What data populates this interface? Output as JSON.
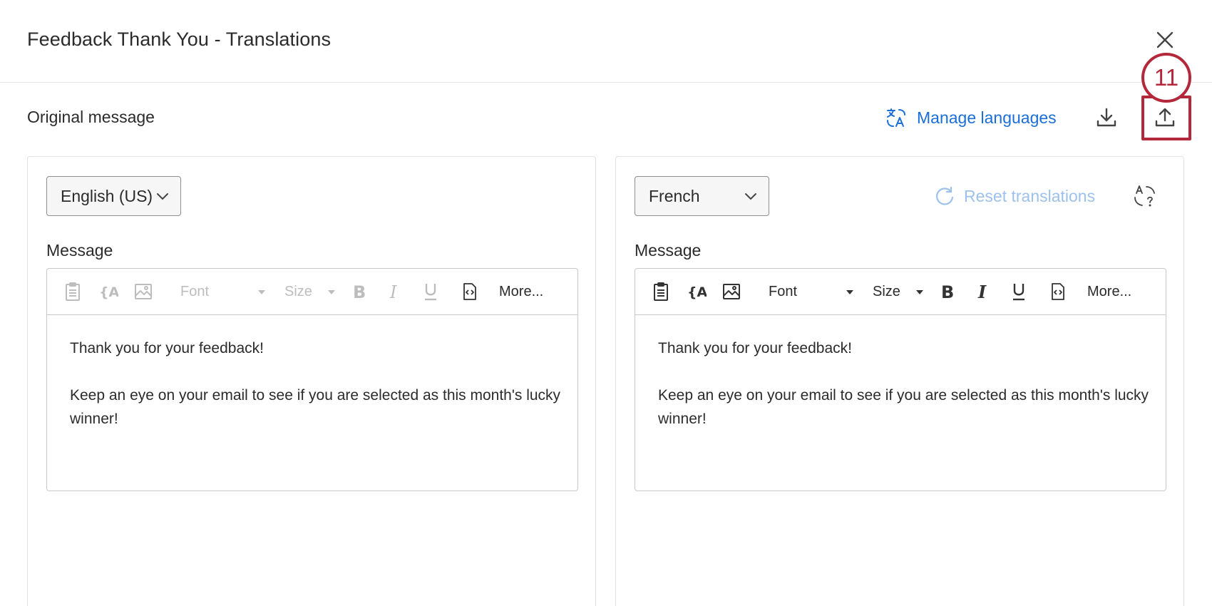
{
  "dialog": {
    "title": "Feedback Thank You - Translations"
  },
  "top_row": {
    "original_label": "Original message",
    "manage_languages_label": "Manage languages"
  },
  "callout": {
    "number": "11"
  },
  "left_panel": {
    "language": "English (US)",
    "message_label": "Message",
    "toolbar": {
      "font_label": "Font",
      "size_label": "Size",
      "more_label": "More..."
    },
    "body": {
      "line1": "Thank you for your feedback!",
      "line2": "Keep an eye on your email to see if you are selected as this month's lucky winner!"
    }
  },
  "right_panel": {
    "language": "French",
    "reset_label": "Reset translations",
    "message_label": "Message",
    "toolbar": {
      "font_label": "Font",
      "size_label": "Size",
      "more_label": "More..."
    },
    "body": {
      "line1": "Thank you for your feedback!",
      "line2": "Keep an eye on your email to see if you are selected as this month's lucky winner!"
    }
  },
  "colors": {
    "accent_blue": "#1a6ed8",
    "disabled_blue": "#9dc1ec",
    "annotation_red": "#b3283a",
    "disabled_icon": "#bdbdbd"
  },
  "icons": {
    "close": "close-icon",
    "translate": "translate-icon",
    "download": "download-icon",
    "upload": "upload-icon",
    "reset": "refresh-icon",
    "detect_language": "detect-language-icon",
    "dropdown": "chevron-down-icon"
  }
}
